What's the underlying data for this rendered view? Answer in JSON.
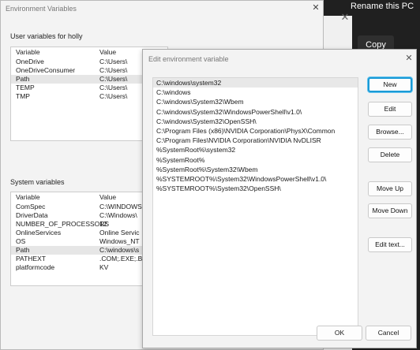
{
  "background": {
    "rename_label": "Rename this PC",
    "copy_label": "Copy",
    "close_glyph": "✕"
  },
  "env_window": {
    "title": "Environment Variables",
    "close_glyph": "✕",
    "user_section_label": "User variables for holly",
    "user_table": {
      "headers": [
        "Variable",
        "Value"
      ],
      "rows": [
        {
          "variable": "OneDrive",
          "value": "C:\\Users\\"
        },
        {
          "variable": "OneDriveConsumer",
          "value": "C:\\Users\\"
        },
        {
          "variable": "Path",
          "value": "C:\\Users\\"
        },
        {
          "variable": "TEMP",
          "value": "C:\\Users\\"
        },
        {
          "variable": "TMP",
          "value": "C:\\Users\\"
        }
      ],
      "selected_row": 2
    },
    "system_section_label": "System variables",
    "system_table": {
      "headers": [
        "Variable",
        "Value"
      ],
      "rows": [
        {
          "variable": "ComSpec",
          "value": "C:\\WINDOWS"
        },
        {
          "variable": "DriverData",
          "value": "C:\\Windows\\"
        },
        {
          "variable": "NUMBER_OF_PROCESSORS",
          "value": "12"
        },
        {
          "variable": "OnlineServices",
          "value": "Online Servic"
        },
        {
          "variable": "OS",
          "value": "Windows_NT"
        },
        {
          "variable": "Path",
          "value": "C:\\windows\\s"
        },
        {
          "variable": "PATHEXT",
          "value": ".COM;.EXE;.B/"
        },
        {
          "variable": "platformcode",
          "value": "KV"
        }
      ],
      "selected_row": 5
    }
  },
  "edit_dialog": {
    "title": "Edit environment variable",
    "close_glyph": "✕",
    "paths": [
      "C:\\windows\\system32",
      "C:\\windows",
      "C:\\windows\\System32\\Wbem",
      "C:\\windows\\System32\\WindowsPowerShell\\v1.0\\",
      "C:\\windows\\System32\\OpenSSH\\",
      "C:\\Program Files (x86)\\NVIDIA Corporation\\PhysX\\Common",
      "C:\\Program Files\\NVIDIA Corporation\\NVIDIA NvDLISR",
      "%SystemRoot%\\system32",
      "%SystemRoot%",
      "%SystemRoot%\\System32\\Wbem",
      "%SYSTEMROOT%\\System32\\WindowsPowerShell\\v1.0\\",
      "%SYSTEMROOT%\\System32\\OpenSSH\\"
    ],
    "selected_path": 0,
    "buttons": {
      "new": "New",
      "edit": "Edit",
      "browse": "Browse...",
      "delete": "Delete",
      "move_up": "Move Up",
      "move_down": "Move Down",
      "edit_text": "Edit text..."
    },
    "ok_label": "OK",
    "cancel_label": "Cancel",
    "accent_color": "#1a9ad6"
  }
}
